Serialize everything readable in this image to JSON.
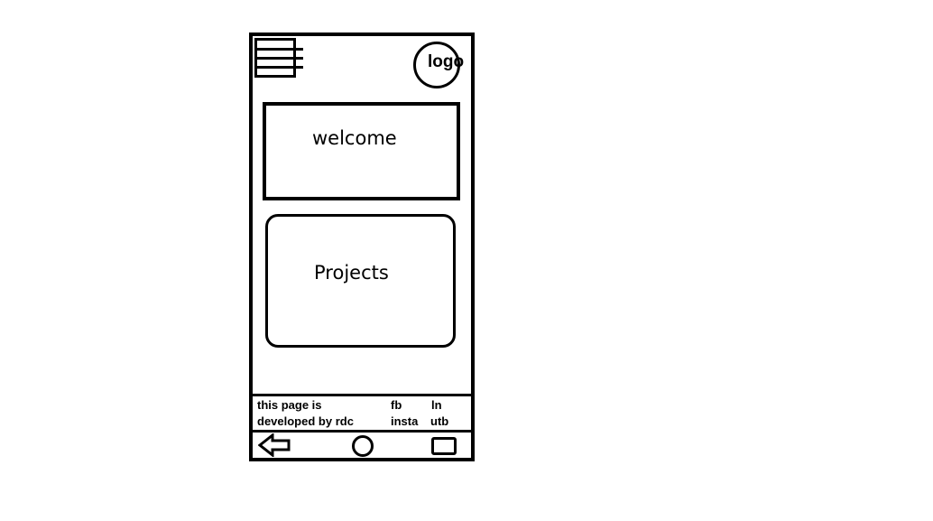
{
  "header": {
    "menu_icon": "hamburger-menu-icon",
    "logo_label": "logo"
  },
  "main": {
    "welcome_label": "welcome",
    "projects_label": "Projects"
  },
  "footer": {
    "credit_line1": "this page is",
    "credit_line2": "developed by rdc",
    "social": {
      "fb": "fb",
      "insta": "insta",
      "ln": "ln",
      "utb": "utb"
    }
  },
  "navbar": {
    "back_icon": "back-arrow-icon",
    "home_icon": "home-circle-icon",
    "recent_icon": "recent-apps-icon"
  }
}
